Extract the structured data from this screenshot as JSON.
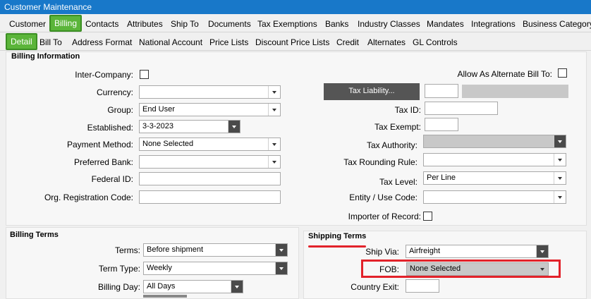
{
  "window": {
    "title": "Customer Maintenance"
  },
  "tabs_main": [
    "Customer",
    "Billing",
    "Contacts",
    "Attributes",
    "Ship To",
    "Documents",
    "Tax Exemptions",
    "Banks",
    "Industry Classes",
    "Mandates",
    "Integrations",
    "Business Category"
  ],
  "tabs_sub": [
    "Detail",
    "Bill To",
    "Address Format",
    "National Account",
    "Price Lists",
    "Discount Price Lists",
    "Credit",
    "Alternates",
    "GL Controls"
  ],
  "billing_info": {
    "title": "Billing Information",
    "inter_company_label": "Inter-Company:",
    "currency_label": "Currency:",
    "group_label": "Group:",
    "group_value": "End User",
    "established_label": "Established:",
    "established_value": "3-3-2023",
    "payment_method_label": "Payment Method:",
    "payment_method_value": "None Selected",
    "preferred_bank_label": "Preferred Bank:",
    "federal_id_label": "Federal ID:",
    "org_reg_label": "Org. Registration Code:",
    "alt_bill_to_label": "Allow As Alternate Bill To:",
    "tax_liability_button": "Tax Liability...",
    "tax_id_label": "Tax ID:",
    "tax_exempt_label": "Tax Exempt:",
    "tax_authority_label": "Tax Authority:",
    "tax_rounding_label": "Tax Rounding Rule:",
    "tax_level_label": "Tax Level:",
    "tax_level_value": "Per Line",
    "entity_use_label": "Entity / Use Code:",
    "importer_label": "Importer of Record:"
  },
  "billing_terms": {
    "title": "Billing Terms",
    "terms_label": "Terms:",
    "terms_value": "Before shipment",
    "term_type_label": "Term Type:",
    "term_type_value": "Weekly",
    "billing_day_label": "Billing Day:",
    "billing_day_value": "All Days"
  },
  "shipping_terms": {
    "title": "Shipping Terms",
    "ship_via_label": "Ship Via:",
    "ship_via_value": "Airfreight",
    "fob_label": "FOB:",
    "fob_value": "None Selected",
    "country_exit_label": "Country Exit:"
  }
}
